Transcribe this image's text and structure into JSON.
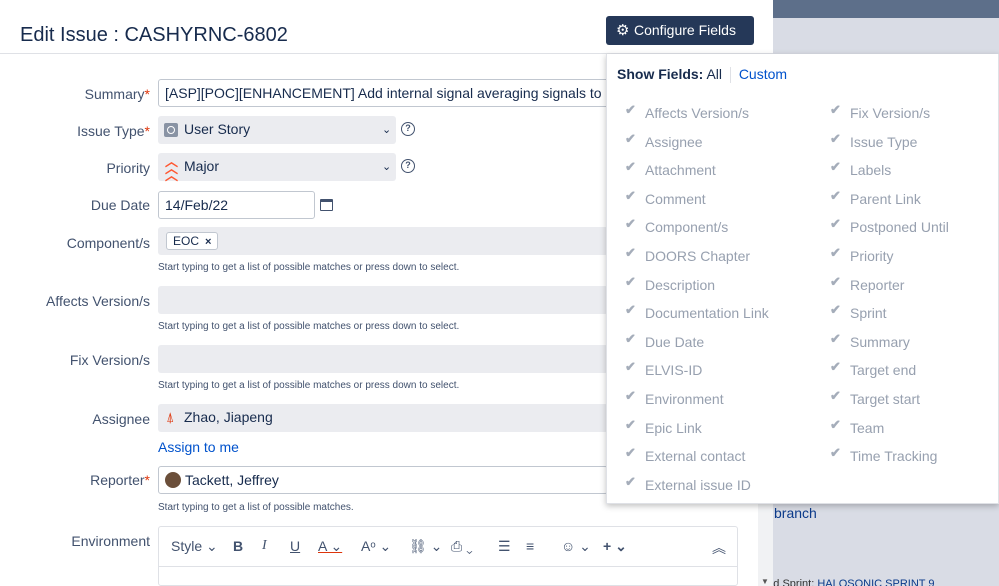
{
  "title": "Edit Issue : CASHYRNC-6802",
  "configure_button": "Configure Fields",
  "fields": {
    "summary": {
      "label": "Summary",
      "value": "[ASP][POC][ENHANCEMENT] Add internal signal averaging signals to State M"
    },
    "issue_type": {
      "label": "Issue Type",
      "value": "User Story"
    },
    "priority": {
      "label": "Priority",
      "value": "Major"
    },
    "due_date": {
      "label": "Due Date",
      "value": "14/Feb/22"
    },
    "components": {
      "label": "Component/s",
      "tag": "EOC",
      "hint": "Start typing to get a list of possible matches or press down to select."
    },
    "affects": {
      "label": "Affects Version/s",
      "hint": "Start typing to get a list of possible matches or press down to select."
    },
    "fix": {
      "label": "Fix Version/s",
      "hint": "Start typing to get a list of possible matches or press down to select."
    },
    "assignee": {
      "label": "Assignee",
      "value": "Zhao, Jiapeng",
      "assign_link": "Assign to me"
    },
    "reporter": {
      "label": "Reporter",
      "value": "Tackett, Jeffrey",
      "hint": "Start typing to get a list of possible matches."
    },
    "environment": {
      "label": "Environment",
      "style": "Style"
    }
  },
  "popup": {
    "show_fields": "Show Fields:",
    "all": "All",
    "custom": "Custom",
    "left": [
      "Affects Version/s",
      "Assignee",
      "Attachment",
      "Comment",
      "Component/s",
      "DOORS Chapter",
      "Description",
      "Documentation Link",
      "Due Date",
      "ELVIS-ID",
      "Environment",
      "Epic Link",
      "External contact",
      "External issue ID"
    ],
    "right": [
      "Fix Version/s",
      "Issue Type",
      "Labels",
      "Parent Link",
      "Postponed Until",
      "Priority",
      "Reporter",
      "Sprint",
      "Summary",
      "Target end",
      "Target start",
      "Team",
      "Time Tracking"
    ]
  },
  "background": {
    "branch": "branch",
    "lastline_text": "ated Sprint: ",
    "lastline_link": "HALOSONIC SPRINT 9"
  }
}
